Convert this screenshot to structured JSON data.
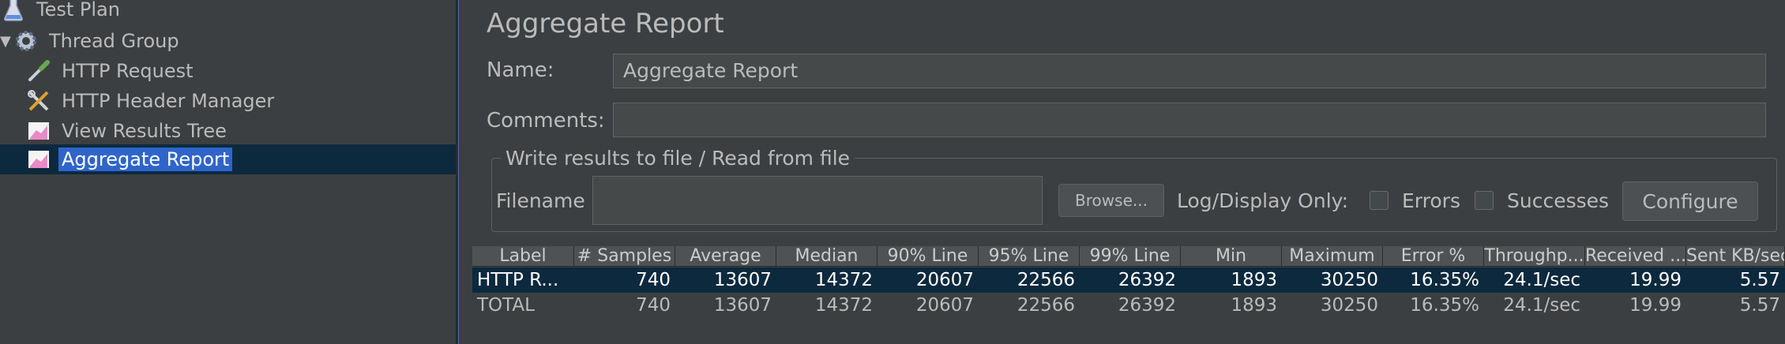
{
  "tree": {
    "items": [
      {
        "label": "Test Plan",
        "icon": "flask-icon"
      },
      {
        "label": "Thread Group",
        "icon": "gear-icon"
      },
      {
        "label": "HTTP Request",
        "icon": "pipette-icon"
      },
      {
        "label": "HTTP Header Manager",
        "icon": "tools-icon"
      },
      {
        "label": "View Results Tree",
        "icon": "graph-icon"
      },
      {
        "label": "Aggregate Report",
        "icon": "graph-icon"
      }
    ]
  },
  "panel": {
    "title": "Aggregate Report",
    "name_label": "Name:",
    "name_value": "Aggregate Report",
    "comments_label": "Comments:",
    "comments_value": "",
    "file_section": "Write results to file / Read from file",
    "filename_label": "Filename",
    "filename_value": "",
    "browse_label": "Browse...",
    "log_display_label": "Log/Display Only:",
    "errors_label": "Errors",
    "successes_label": "Successes",
    "configure_label": "Configure"
  },
  "table": {
    "columns": [
      "Label",
      "# Samples",
      "Average",
      "Median",
      "90% Line",
      "95% Line",
      "99% Line",
      "Min",
      "Maximum",
      "Error %",
      "Throughp...",
      "Received ...",
      "Sent KB/sec"
    ],
    "rows": [
      [
        "HTTP R...",
        "740",
        "13607",
        "14372",
        "20607",
        "22566",
        "26392",
        "1893",
        "30250",
        "16.35%",
        "24.1/sec",
        "19.99",
        "5.57"
      ],
      [
        "TOTAL",
        "740",
        "13607",
        "14372",
        "20607",
        "22566",
        "26392",
        "1893",
        "30250",
        "16.35%",
        "24.1/sec",
        "19.99",
        "5.57"
      ]
    ]
  },
  "colors": {
    "background": "#3c3f41",
    "selection": "#2f65ca",
    "selected_row": "#0d293e",
    "text": "#bbbbbb"
  }
}
